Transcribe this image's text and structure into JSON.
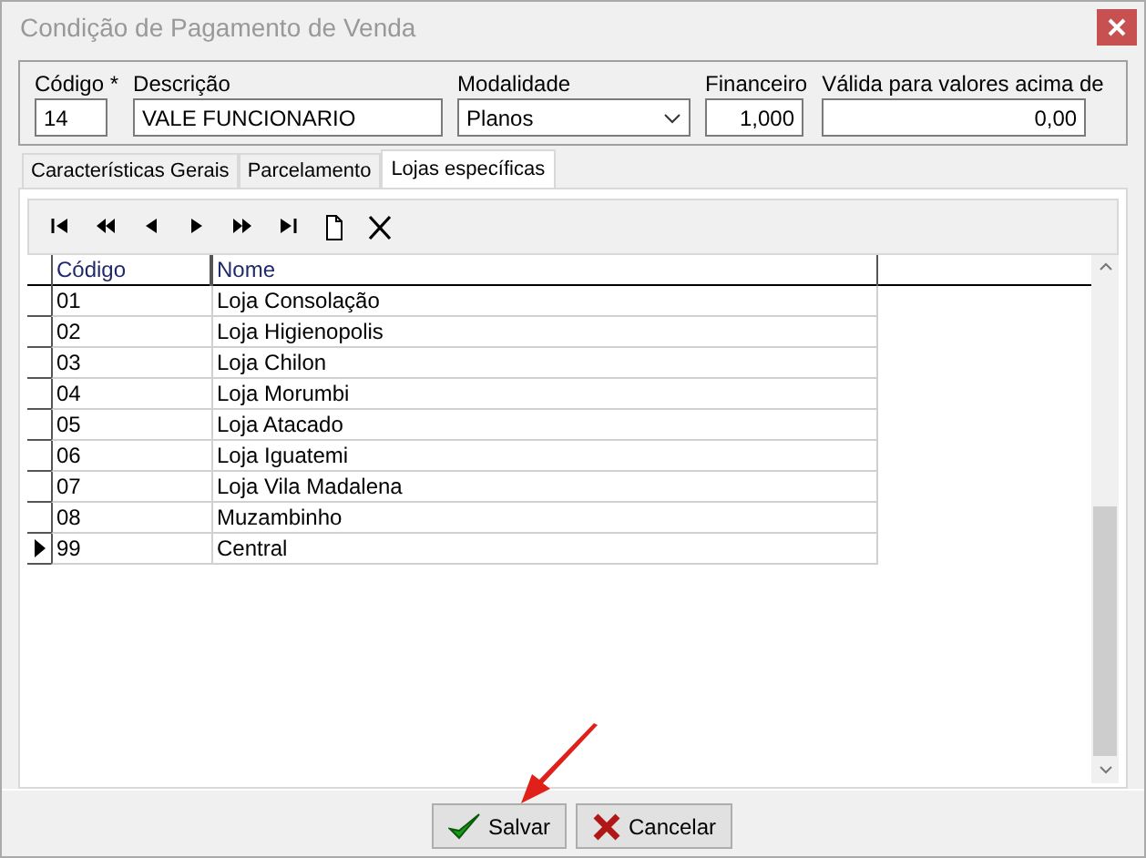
{
  "window": {
    "title": "Condição de Pagamento de Venda"
  },
  "fields": [
    {
      "label": "Código *",
      "value": "14",
      "kind": "text"
    },
    {
      "label": "Descrição",
      "value": "VALE FUNCIONARIO",
      "kind": "text"
    },
    {
      "label": "Modalidade",
      "value": "Planos",
      "kind": "dropdown"
    },
    {
      "label": "Financeiro",
      "value": "1,000",
      "kind": "number"
    },
    {
      "label": "Válida para valores acima de",
      "value": "0,00",
      "kind": "number"
    }
  ],
  "tabs": [
    {
      "label": "Características Gerais",
      "selected": false
    },
    {
      "label": "Parcelamento",
      "selected": false
    },
    {
      "label": "Lojas específicas",
      "selected": true
    }
  ],
  "table": {
    "columns": [
      "Código",
      "Nome"
    ],
    "rows": [
      {
        "codigo": "01",
        "nome": "Loja Consolação",
        "selected": false
      },
      {
        "codigo": "02",
        "nome": "Loja Higienopolis",
        "selected": false
      },
      {
        "codigo": "03",
        "nome": "Loja Chilon",
        "selected": false
      },
      {
        "codigo": "04",
        "nome": "Loja Morumbi",
        "selected": false
      },
      {
        "codigo": "05",
        "nome": "Loja Atacado",
        "selected": false
      },
      {
        "codigo": "06",
        "nome": "Loja Iguatemi",
        "selected": false
      },
      {
        "codigo": "07",
        "nome": "Loja Vila Madalena",
        "selected": false
      },
      {
        "codigo": "08",
        "nome": "Muzambinho",
        "selected": false
      },
      {
        "codigo": "99",
        "nome": "Central",
        "selected": true
      }
    ]
  },
  "buttons": [
    {
      "label": "Salvar",
      "kind": "ok"
    },
    {
      "label": "Cancelar",
      "kind": "cancel"
    }
  ]
}
